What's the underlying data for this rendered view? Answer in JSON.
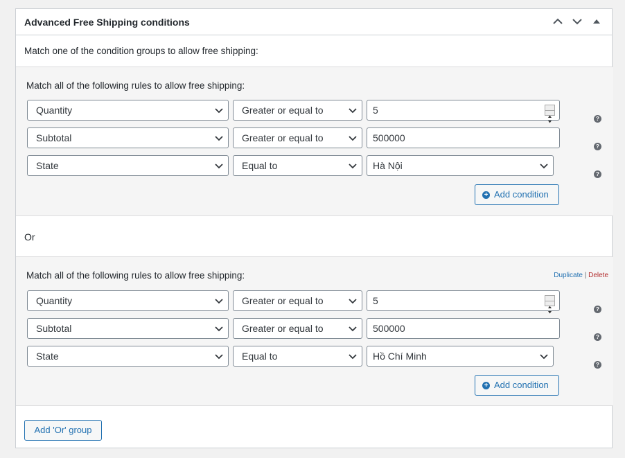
{
  "box": {
    "title": "Advanced Free Shipping conditions",
    "match_groups_label": "Match one of the condition groups to allow free shipping:",
    "or_label": "Or",
    "add_or_group_label": "Add 'Or' group"
  },
  "groups": [
    {
      "label": "Match all of the following rules to allow free shipping:",
      "rows": [
        {
          "field": "Quantity",
          "operator": "Greater or equal to",
          "value": "5"
        },
        {
          "field": "Subtotal",
          "operator": "Greater or equal to",
          "value": "500000"
        },
        {
          "field": "State",
          "operator": "Equal to",
          "value": "Hà Nội"
        }
      ],
      "add_condition_label": "Add condition"
    },
    {
      "label": "Match all of the following rules to allow free shipping:",
      "duplicate_label": "Duplicate",
      "separator": "|",
      "delete_label": "Delete",
      "rows": [
        {
          "field": "Quantity",
          "operator": "Greater or equal to",
          "value": "5"
        },
        {
          "field": "Subtotal",
          "operator": "Greater or equal to",
          "value": "500000"
        },
        {
          "field": "State",
          "operator": "Equal to",
          "value": "Hồ Chí Minh"
        }
      ],
      "add_condition_label": "Add condition"
    }
  ],
  "icons": {
    "move_up": "chevron-up-icon",
    "move_down": "chevron-down-icon",
    "toggle": "triangle-up-icon",
    "help": "help-icon",
    "add": "plus-circle-icon"
  },
  "colors": {
    "accent": "#2271b1",
    "delete": "#b32d2e",
    "border": "#7e8993"
  }
}
